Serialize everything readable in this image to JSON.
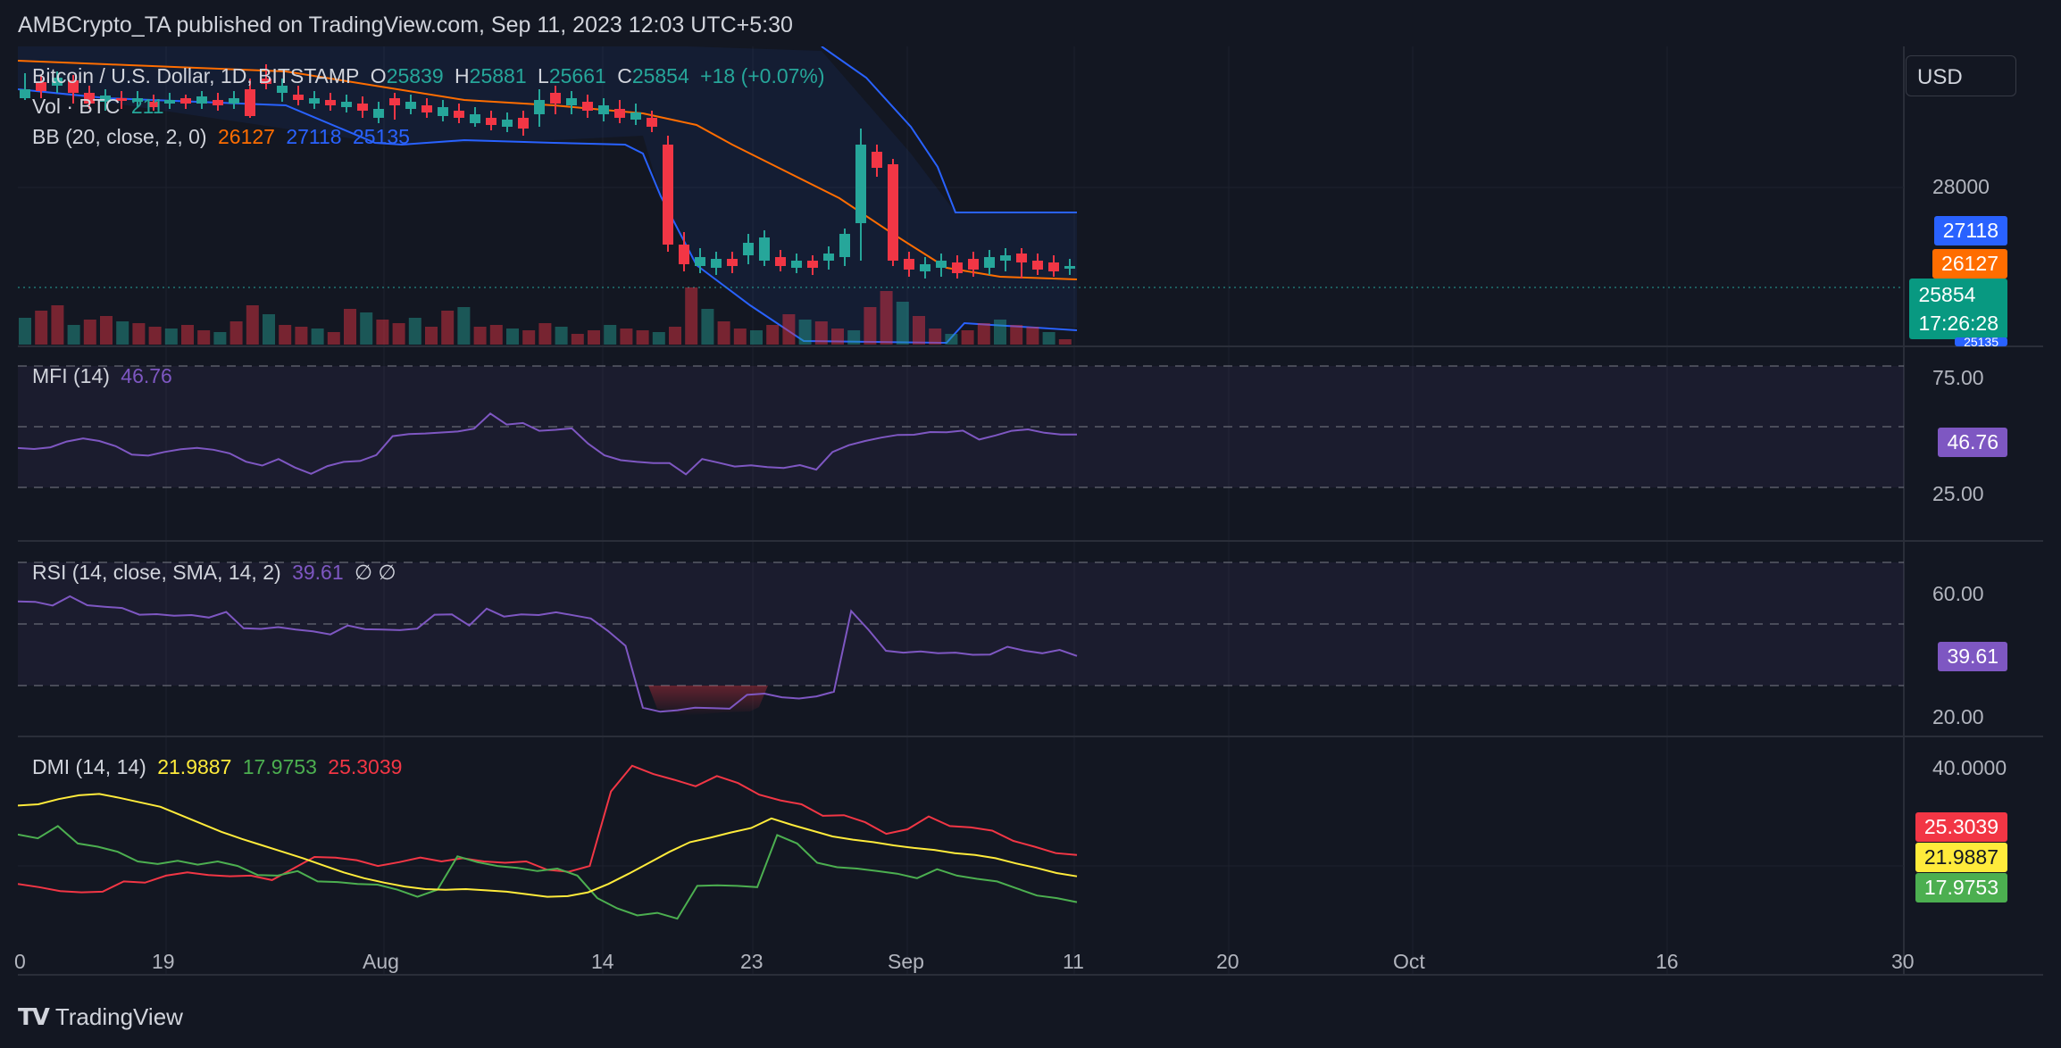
{
  "publisher_line": "AMBCrypto_TA published on TradingView.com, Sep 11, 2023 12:03 UTC+5:30",
  "currency_button": "USD",
  "main_legend": {
    "symbol": "Bitcoin / U.S. Dollar, 1D, BITSTAMP",
    "o_label": "O",
    "o_value": "25839",
    "h_label": "H",
    "h_value": "25881",
    "l_label": "L",
    "l_value": "25661",
    "c_label": "C",
    "c_value": "25854",
    "change": "+18 (+0.07%)",
    "vol_label": "Vol · BTC",
    "vol_value": "211",
    "bb_label": "BB (20, close, 2, 0)",
    "bb_basis": "26127",
    "bb_upper": "27118",
    "bb_lower": "25135"
  },
  "price_axis": {
    "tick": "28000"
  },
  "price_badges": {
    "upper": "27118",
    "basis": "26127",
    "last": "25854",
    "countdown": "17:26:28",
    "lower_partial": "25135"
  },
  "mfi": {
    "label": "MFI (14)",
    "value": "46.76",
    "ticks": [
      "75.00",
      "25.00"
    ],
    "badge": "46.76"
  },
  "rsi": {
    "label": "RSI (14, close, SMA, 14, 2)",
    "value": "39.61",
    "extra": "∅ ∅",
    "ticks": [
      "60.00",
      "20.00"
    ],
    "badge": "39.61"
  },
  "dmi": {
    "label": "DMI (14, 14)",
    "adx": "21.9887",
    "plus_di": "17.9753",
    "minus_di": "25.3039",
    "tick": "40.0000",
    "badges": [
      "25.3039",
      "21.9887",
      "17.9753"
    ]
  },
  "time_axis": [
    "0",
    "19",
    "Aug",
    "14",
    "23",
    "Sep",
    "11",
    "20",
    "Oct",
    "16",
    "30"
  ],
  "footer_brand": "TradingView",
  "colors": {
    "bg": "#131722",
    "up": "#26a69a",
    "down": "#f23645",
    "bb_upper": "#2962ff",
    "bb_basis": "#ff6d00",
    "mfi": "#7e57c2",
    "adx": "#ffeb3b",
    "plus_di": "#4caf50",
    "minus_di": "#f23645"
  },
  "chart_data": {
    "type": "line",
    "series": [
      {
        "name": "MFI (14)",
        "values": [
          41.2,
          40.8,
          41.5,
          43.9,
          45.2,
          44.1,
          42.0,
          38.5,
          38.1,
          39.6,
          40.7,
          41.3,
          40.5,
          39.0,
          35.6,
          34.0,
          36.7,
          33.2,
          30.6,
          33.8,
          35.5,
          35.9,
          38.3,
          46.1,
          47.0,
          47.2,
          47.6,
          48.0,
          49.2,
          55.4,
          50.9,
          51.5,
          48.3,
          48.7,
          49.3,
          43.0,
          38.2,
          36.2,
          35.5,
          35.0,
          35.0,
          30.4,
          36.7,
          35.2,
          33.6,
          34.1,
          33.4,
          33.0,
          34.2,
          32.3,
          39.6,
          42.4,
          44.1,
          45.5,
          46.6,
          46.7,
          47.8,
          47.7,
          48.4,
          44.7,
          46.4,
          48.3,
          48.9,
          47.5,
          46.8,
          46.76
        ]
      },
      {
        "name": "RSI (14, close, SMA, 14, 2)",
        "values": [
          57.3,
          57.2,
          56.0,
          59.0,
          56.1,
          55.6,
          55.2,
          53.0,
          53.2,
          52.7,
          52.9,
          52.1,
          53.9,
          48.6,
          48.4,
          49.0,
          48.2,
          47.6,
          46.6,
          49.5,
          48.3,
          48.2,
          48.0,
          48.5,
          53.0,
          53.1,
          49.5,
          55.0,
          52.4,
          53.1,
          52.9,
          53.8,
          52.8,
          51.8,
          47.7,
          42.9,
          22.8,
          21.5,
          22.0,
          22.8,
          22.7,
          22.5,
          27.0,
          27.4,
          26.2,
          25.8,
          26.5,
          28.0,
          54.2,
          48.1,
          41.3,
          40.7,
          41.1,
          40.5,
          40.7,
          40.0,
          40.1,
          42.6,
          41.3,
          40.5,
          41.6,
          39.61
        ]
      },
      {
        "name": "ADX",
        "values": [
          33.0,
          33.2,
          34.0,
          34.6,
          34.8,
          34.2,
          33.5,
          32.8,
          31.5,
          30.2,
          28.9,
          27.8,
          26.8,
          25.8,
          24.8,
          23.7,
          22.6,
          21.7,
          21.0,
          20.4,
          20.0,
          19.9,
          20.0,
          19.8,
          19.6,
          19.2,
          18.8,
          18.9,
          19.5,
          20.8,
          22.4,
          24.1,
          25.8,
          27.3,
          28.0,
          28.8,
          29.5,
          31.0,
          30.0,
          29.1,
          28.2,
          27.7,
          27.3,
          26.8,
          26.4,
          26.1,
          25.6,
          25.3,
          24.8,
          24.0,
          23.3,
          22.5,
          21.9887
        ]
      },
      {
        "name": "+DI",
        "values": [
          28.5,
          27.9,
          29.8,
          27.1,
          26.6,
          25.8,
          24.3,
          23.9,
          24.4,
          23.8,
          24.3,
          23.6,
          22.2,
          22.1,
          22.8,
          21.2,
          21.1,
          20.8,
          20.7,
          19.9,
          18.8,
          19.9,
          25.1,
          24.2,
          23.6,
          23.3,
          22.8,
          23.2,
          22.1,
          18.6,
          17.0,
          15.9,
          16.3,
          15.4,
          20.5,
          20.6,
          20.5,
          20.3,
          28.4,
          27.1,
          24.1,
          23.4,
          23.2,
          22.8,
          22.4,
          21.7,
          23.1,
          22.1,
          21.6,
          21.2,
          20.1,
          19.0,
          18.6,
          17.9753
        ]
      },
      {
        "name": "-DI",
        "values": [
          20.8,
          20.3,
          19.7,
          19.5,
          19.6,
          21.2,
          21.0,
          22.1,
          22.6,
          22.2,
          22.0,
          22.1,
          21.4,
          23.2,
          25.0,
          24.9,
          24.5,
          23.6,
          24.2,
          24.9,
          24.3,
          24.8,
          24.3,
          24.1,
          24.3,
          23.0,
          22.7,
          23.6,
          35.2,
          39.2,
          37.9,
          37.0,
          36.0,
          37.6,
          36.5,
          34.7,
          33.8,
          33.2,
          31.4,
          31.5,
          30.4,
          28.6,
          29.3,
          31.3,
          29.8,
          29.6,
          29.1,
          27.5,
          26.6,
          25.6,
          25.3039
        ]
      }
    ]
  }
}
